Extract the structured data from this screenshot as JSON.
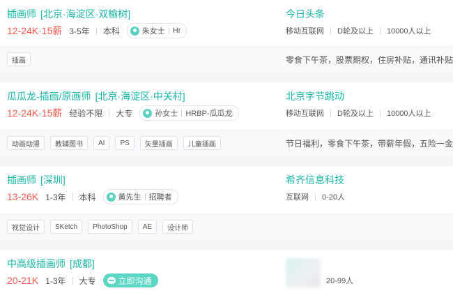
{
  "jobs": [
    {
      "title": "插画师",
      "location": "[北京·海淀区·双榆树]",
      "salary": "12-24K·15薪",
      "experience": "3-5年",
      "education": "本科",
      "recruiter_name": "朱女士",
      "recruiter_role": "Hr",
      "company": "今日头条",
      "company_industry": "移动互联网",
      "company_stage": "D轮及以上",
      "company_size": "10000人以上",
      "skills": [
        "插画"
      ],
      "benefits": "零食下午茶，股票期权，住房补贴，通讯补贴，年"
    },
    {
      "title": "瓜瓜龙-插画/原画师",
      "location": "[北京·海淀区·中关村]",
      "salary": "12-24K·15薪",
      "experience": "经验不限",
      "education": "大专",
      "recruiter_name": "孙女士",
      "recruiter_role": "HRBP-瓜瓜龙",
      "company": "北京字节跳动",
      "company_industry": "移动互联网",
      "company_stage": "D轮及以上",
      "company_size": "10000人以上",
      "skills": [
        "动画动漫",
        "教辅图书",
        "AI",
        "PS",
        "矢量插画",
        "儿童插画"
      ],
      "benefits": "节日福利，零食下午茶，带薪年假，五险一金，六"
    },
    {
      "title": "插画师",
      "location": "[深圳]",
      "salary": "13-26K",
      "experience": "1-3年",
      "education": "本科",
      "recruiter_name": "黄先生",
      "recruiter_role": "招聘者",
      "company": "希齐信息科技",
      "company_industry": "互联网",
      "company_size": "0-20人",
      "skills": [
        "视觉设计",
        "SKetch",
        "PhotoShop",
        "AE",
        "设计师"
      ]
    },
    {
      "title": "中高级插画师",
      "location": "[成都]",
      "salary": "20-21K",
      "experience": "1-3年",
      "education": "大专",
      "chat_label": "立即沟通",
      "company_size": "20-99人"
    }
  ],
  "icons": {
    "avatar": "person-avatar-icon",
    "chat": "chat-bubble-icon"
  },
  "colors": {
    "accent": "#16b6a7",
    "salary": "#fe574a",
    "chat_button": "#5cd6c5"
  }
}
